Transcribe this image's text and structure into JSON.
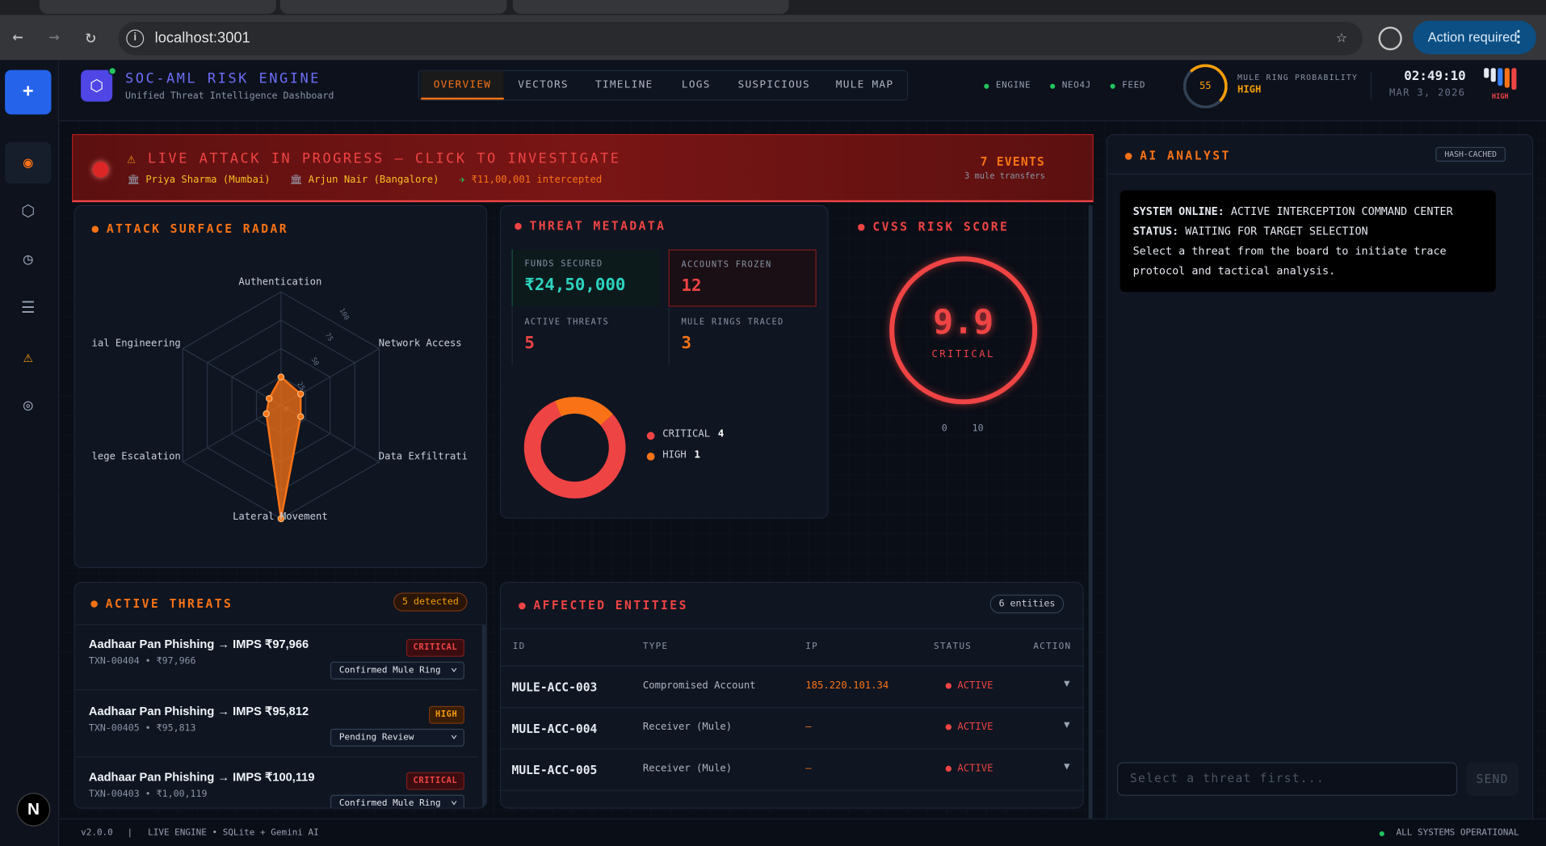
{
  "browser": {
    "url": "localhost:3001",
    "action_label": "Action required"
  },
  "header": {
    "brand": "SOC-AML RISK ENGINE",
    "subtitle": "Unified Threat Intelligence Dashboard",
    "tabs": [
      {
        "label": "OVERVIEW",
        "active": true
      },
      {
        "label": "VECTORS"
      },
      {
        "label": "TIMELINE"
      },
      {
        "label": "LOGS"
      },
      {
        "label": "SUSPICIOUS"
      },
      {
        "label": "MULE MAP"
      }
    ],
    "status": [
      "ENGINE",
      "NEO4J",
      "FEED"
    ],
    "gauge_value": "55",
    "mule_label": "MULE RING PROBABILITY",
    "mule_value": "HIGH",
    "clock": "02:49:10",
    "date": "MAR 3, 2026",
    "level_label": "HIGH"
  },
  "banner": {
    "title": "LIVE ATTACK IN PROGRESS — CLICK TO INVESTIGATE",
    "sender": "Priya Sharma (Mumbai)",
    "receiver": "Arjun Nair (Bangalore)",
    "amount": "₹11,00,001 intercepted",
    "events": "7 EVENTS",
    "events_sub": "3 mule transfers"
  },
  "radar": {
    "title": "ATTACK SURFACE RADAR",
    "axes": [
      "Authentication",
      "Network Access",
      "Data Exfiltrati",
      "Lateral Movement",
      "lege Escalation",
      "ial Engineering"
    ],
    "ticks": [
      "0",
      "25",
      "50",
      "75",
      "100"
    ],
    "values": [
      25,
      20,
      20,
      100,
      15,
      12
    ]
  },
  "metadata": {
    "title": "THREAT METADATA",
    "funds_label": "FUNDS SECURED",
    "funds_value": "₹24,50,000",
    "frozen_label": "ACCOUNTS FROZEN",
    "frozen_value": "12",
    "threats_label": "ACTIVE THREATS",
    "threats_value": "5",
    "rings_label": "MULE RINGS TRACED",
    "rings_value": "3",
    "donut": [
      {
        "name": "CRITICAL",
        "value": 4,
        "color": "#ef4444"
      },
      {
        "name": "HIGH",
        "value": 1,
        "color": "#f97316"
      }
    ]
  },
  "cvss": {
    "title": "CVSS RISK SCORE",
    "score": "9.9",
    "level": "CRITICAL",
    "min": "0",
    "max": "10"
  },
  "ai": {
    "title": "AI ANALYST",
    "badge": "HASH-CACHED",
    "line1_key": "SYSTEM ONLINE:",
    "line1_val": "ACTIVE INTERCEPTION COMMAND CENTER",
    "line2_key": "STATUS:",
    "line2_val": "WAITING FOR TARGET SELECTION",
    "line3": "Select a threat from the board to initiate trace protocol and tactical analysis.",
    "placeholder": "Select a threat first...",
    "send": "SEND"
  },
  "threats": {
    "title": "ACTIVE THREATS",
    "badge": "5 detected",
    "items": [
      {
        "title": "Aadhaar Pan Phishing → IMPS ₹97,966",
        "sub": "TXN-00404 • ₹97,966",
        "level": "CRITICAL",
        "status": "Confirmed Mule Ring"
      },
      {
        "title": "Aadhaar Pan Phishing → IMPS ₹95,812",
        "sub": "TXN-00405 • ₹95,813",
        "level": "HIGH",
        "status": "Pending Review"
      },
      {
        "title": "Aadhaar Pan Phishing → IMPS ₹100,119",
        "sub": "TXN-00403 • ₹1,00,119",
        "level": "CRITICAL",
        "status": "Confirmed Mule Ring"
      }
    ]
  },
  "entities": {
    "title": "AFFECTED ENTITIES",
    "badge": "6 entities",
    "columns": [
      "ID",
      "TYPE",
      "IP",
      "STATUS",
      "ACTION"
    ],
    "rows": [
      {
        "id": "MULE-ACC-003",
        "type": "Compromised Account",
        "ip": "185.220.101.34",
        "status": "ACTIVE"
      },
      {
        "id": "MULE-ACC-004",
        "type": "Receiver (Mule)",
        "ip": "—",
        "status": "ACTIVE"
      },
      {
        "id": "MULE-ACC-005",
        "type": "Receiver (Mule)",
        "ip": "—",
        "status": "ACTIVE"
      }
    ]
  },
  "footer": {
    "version": "v2.0.0",
    "sep": "|",
    "engine": "LIVE ENGINE • SQLite + Gemini AI",
    "status": "ALL SYSTEMS OPERATIONAL"
  }
}
